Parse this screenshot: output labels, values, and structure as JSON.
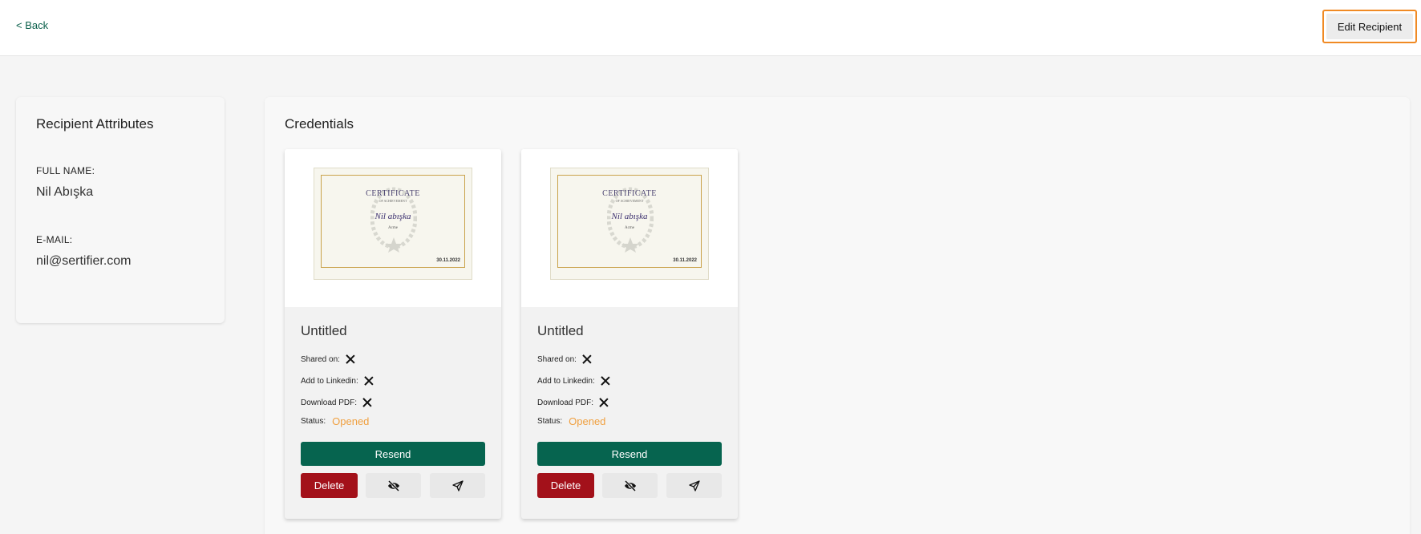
{
  "header": {
    "back_label": "< Back",
    "edit_label": "Edit Recipient"
  },
  "recipient": {
    "title": "Recipient Attributes",
    "fullname_label": "FULL NAME:",
    "fullname_value": "Nil Abışka",
    "email_label": "E-MAIL:",
    "email_value": "nil@sertifier.com"
  },
  "credentials": {
    "title": "Credentials",
    "cards": [
      {
        "cert_heading": "CERTIFICATE",
        "cert_sub": "OF ACHIEVEMENT",
        "cert_name": "Nil abışka",
        "cert_org": "Acme",
        "cert_date": "30.11.2022",
        "name": "Untitled",
        "shared_label": "Shared on:",
        "linkedin_label": "Add to Linkedin:",
        "pdf_label": "Download PDF:",
        "status_label": "Status:",
        "status_value": "Opened",
        "resend_label": "Resend",
        "delete_label": "Delete"
      },
      {
        "cert_heading": "CERTIFICATE",
        "cert_sub": "OF ACHIEVEMENT",
        "cert_name": "Nil abışka",
        "cert_org": "Acme",
        "cert_date": "30.11.2022",
        "name": "Untitled",
        "shared_label": "Shared on:",
        "linkedin_label": "Add to Linkedin:",
        "pdf_label": "Download PDF:",
        "status_label": "Status:",
        "status_value": "Opened",
        "resend_label": "Resend",
        "delete_label": "Delete"
      }
    ]
  },
  "colors": {
    "accent_green": "#06644f",
    "danger_red": "#a3111a",
    "status_orange": "#f0a040",
    "highlight_orange": "#f08a24"
  },
  "icons": {
    "share_status": "close-icon",
    "hide": "eye-off-icon",
    "send": "send-icon"
  }
}
